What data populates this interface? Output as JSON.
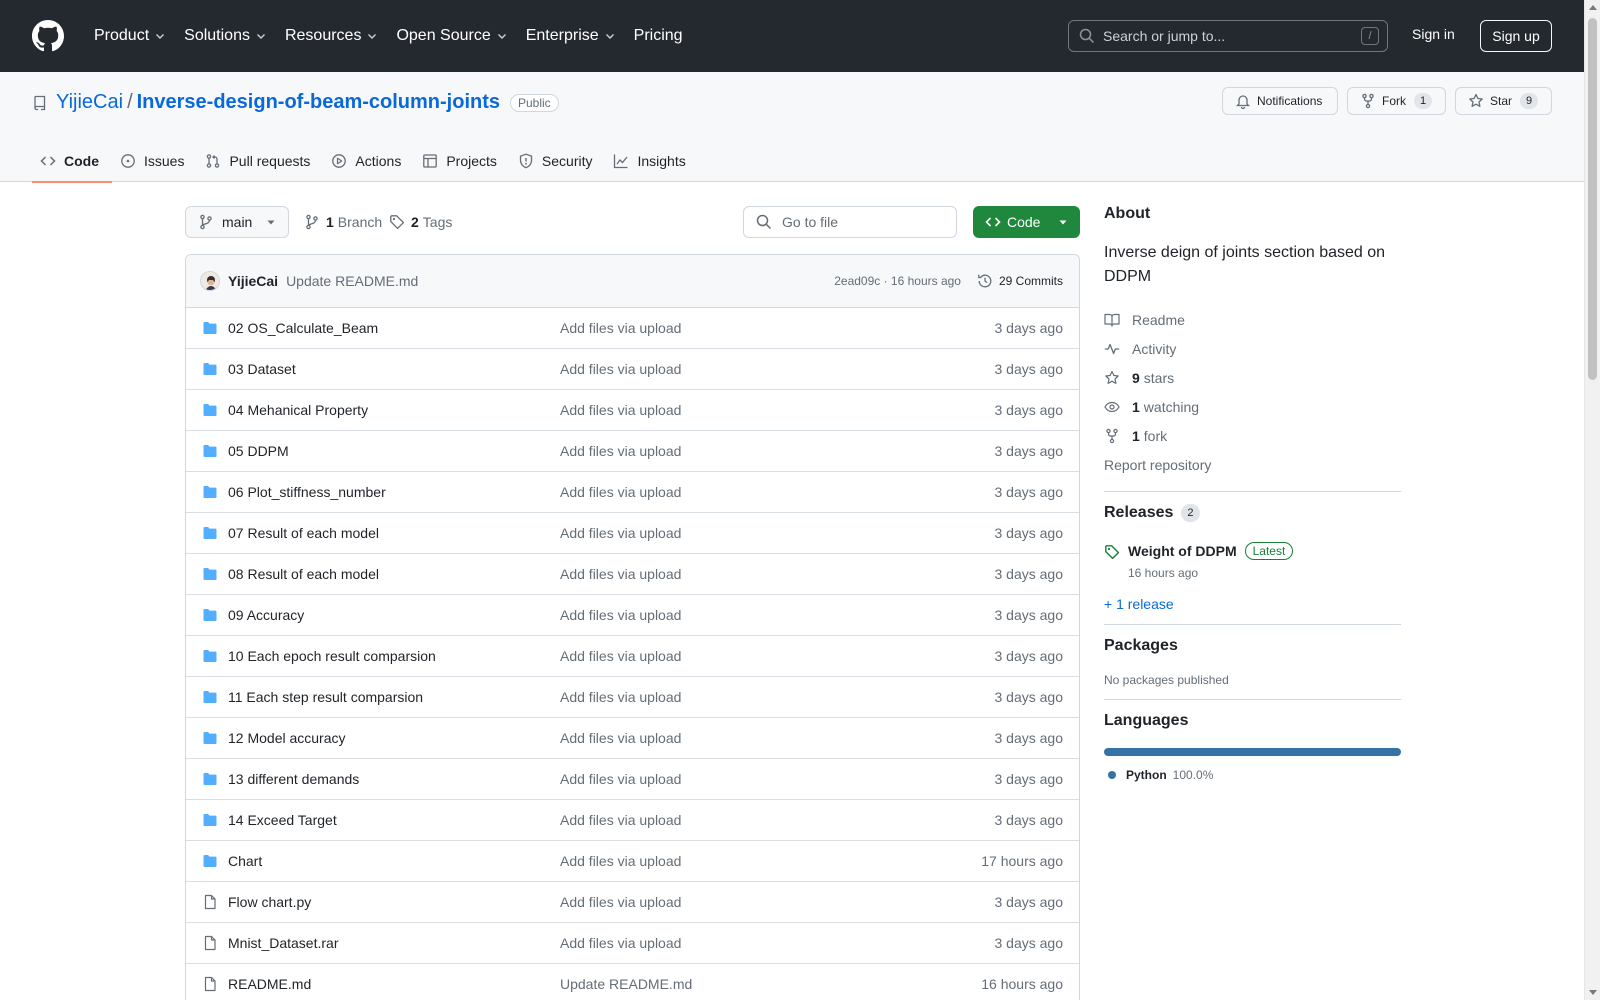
{
  "header": {
    "nav": [
      {
        "label": "Product",
        "has_menu": true
      },
      {
        "label": "Solutions",
        "has_menu": true
      },
      {
        "label": "Resources",
        "has_menu": true
      },
      {
        "label": "Open Source",
        "has_menu": true
      },
      {
        "label": "Enterprise",
        "has_menu": true
      },
      {
        "label": "Pricing",
        "has_menu": false
      }
    ],
    "search_placeholder": "Search or jump to...",
    "search_shortcut": "/",
    "sign_in": "Sign in",
    "sign_up": "Sign up"
  },
  "repo": {
    "owner": "YijieCai",
    "separator": "/",
    "name": "Inverse-design-of-beam-column-joints",
    "visibility": "Public",
    "notifications_label": "Notifications",
    "fork_label": "Fork",
    "fork_count": "1",
    "star_label": "Star",
    "star_count": "9"
  },
  "tabs": [
    {
      "label": "Code",
      "icon": "code-icon",
      "active": true
    },
    {
      "label": "Issues",
      "icon": "issue-icon",
      "active": false
    },
    {
      "label": "Pull requests",
      "icon": "pull-request-icon",
      "active": false
    },
    {
      "label": "Actions",
      "icon": "play-icon",
      "active": false
    },
    {
      "label": "Projects",
      "icon": "table-icon",
      "active": false
    },
    {
      "label": "Security",
      "icon": "shield-icon",
      "active": false
    },
    {
      "label": "Insights",
      "icon": "graph-icon",
      "active": false
    }
  ],
  "toolbar": {
    "branch": "main",
    "branch_count": "1",
    "branch_label": "Branch",
    "tag_count": "2",
    "tag_label": "Tags",
    "go_to_file": "Go to file",
    "code_button": "Code"
  },
  "latest_commit": {
    "author": "YijieCai",
    "message": "Update README.md",
    "meta": "2ead09c · 16 hours ago",
    "commits_label": "29 Commits"
  },
  "files": [
    {
      "type": "folder",
      "name": "02 OS_Calculate_Beam",
      "message": "Add files via upload",
      "age": "3 days ago"
    },
    {
      "type": "folder",
      "name": "03 Dataset",
      "message": "Add files via upload",
      "age": "3 days ago"
    },
    {
      "type": "folder",
      "name": "04 Mehanical Property",
      "message": "Add files via upload",
      "age": "3 days ago"
    },
    {
      "type": "folder",
      "name": "05 DDPM",
      "message": "Add files via upload",
      "age": "3 days ago"
    },
    {
      "type": "folder",
      "name": "06 Plot_stiffness_number",
      "message": "Add files via upload",
      "age": "3 days ago"
    },
    {
      "type": "folder",
      "name": "07 Result of each model",
      "message": "Add files via upload",
      "age": "3 days ago"
    },
    {
      "type": "folder",
      "name": "08 Result of each model",
      "message": "Add files via upload",
      "age": "3 days ago"
    },
    {
      "type": "folder",
      "name": "09 Accuracy",
      "message": "Add files via upload",
      "age": "3 days ago"
    },
    {
      "type": "folder",
      "name": "10 Each epoch result comparsion",
      "message": "Add files via upload",
      "age": "3 days ago"
    },
    {
      "type": "folder",
      "name": "11 Each step result comparsion",
      "message": "Add files via upload",
      "age": "3 days ago"
    },
    {
      "type": "folder",
      "name": "12 Model accuracy",
      "message": "Add files via upload",
      "age": "3 days ago"
    },
    {
      "type": "folder",
      "name": "13 different demands",
      "message": "Add files via upload",
      "age": "3 days ago"
    },
    {
      "type": "folder",
      "name": "14 Exceed Target",
      "message": "Add files via upload",
      "age": "3 days ago"
    },
    {
      "type": "folder",
      "name": "Chart",
      "message": "Add files via upload",
      "age": "17 hours ago"
    },
    {
      "type": "file",
      "name": "Flow chart.py",
      "message": "Add files via upload",
      "age": "3 days ago"
    },
    {
      "type": "file",
      "name": "Mnist_Dataset.rar",
      "message": "Add files via upload",
      "age": "3 days ago"
    },
    {
      "type": "file",
      "name": "README.md",
      "message": "Update README.md",
      "age": "16 hours ago"
    }
  ],
  "about": {
    "title": "About",
    "description": "Inverse deign of joints section based on DDPM",
    "readme": "Readme",
    "activity": "Activity",
    "stars_count": "9",
    "stars_label": "stars",
    "watching_count": "1",
    "watching_label": "watching",
    "forks_count": "1",
    "forks_label": "fork",
    "report": "Report repository"
  },
  "releases": {
    "title": "Releases",
    "count": "2",
    "latest_name": "Weight of DDPM",
    "latest_badge": "Latest",
    "latest_time": "16 hours ago",
    "more_link": "+ 1 release"
  },
  "packages": {
    "title": "Packages",
    "empty_text": "No packages published"
  },
  "languages": {
    "title": "Languages",
    "items": [
      {
        "name": "Python",
        "percent": "100.0%",
        "color": "#3572A5"
      }
    ]
  },
  "colors": {
    "header_bg": "#24292f",
    "link": "#0969da",
    "primary_button": "#1f883d",
    "active_tab_underline": "#fd8c73",
    "folder_icon": "#54aeff"
  }
}
